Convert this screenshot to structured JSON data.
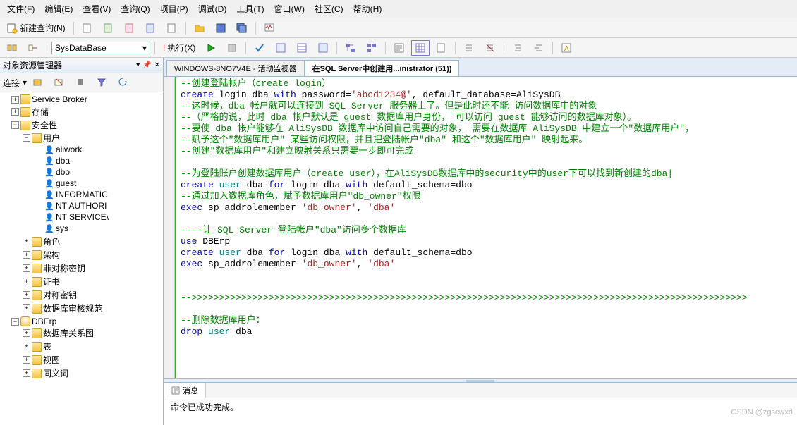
{
  "menu": {
    "file": "文件(F)",
    "edit": "编辑(E)",
    "view": "查看(V)",
    "query": "查询(Q)",
    "project": "项目(P)",
    "debug": "调试(D)",
    "tools": "工具(T)",
    "window": "窗口(W)",
    "community": "社区(C)",
    "help": "帮助(H)"
  },
  "toolbar1": {
    "newquery": "新建查询(N)"
  },
  "toolbar2": {
    "database": "SysDataBase",
    "execute": "执行(X)"
  },
  "left_panel": {
    "title": "对象资源管理器",
    "connect": "连接"
  },
  "tree": {
    "svc_broker": "Service Broker",
    "storage": "存储",
    "security": "安全性",
    "users": "用户",
    "u_aliwork": "aliwork",
    "u_dba": "dba",
    "u_dbo": "dbo",
    "u_guest": "guest",
    "u_info": "INFORMATIC",
    "u_nta": "NT AUTHORI",
    "u_nts": "NT SERVICE\\",
    "u_sys": "sys",
    "roles": "角色",
    "schemas": "架构",
    "asymkeys": "非对称密钥",
    "certs": "证书",
    "symkeys": "对称密钥",
    "audit": "数据库审核规范",
    "dberp": "DBErp",
    "diagrams": "数据库关系图",
    "tables": "表",
    "views": "视图",
    "synonyms": "同义词"
  },
  "tabs": {
    "t1": "WINDOWS-8NO7V4E - 活动监视器",
    "t2": "在SQL Server中创建用...inistrator (51))"
  },
  "code": [
    {
      "t": "--创建登陆帐户（create login）",
      "c": "green"
    },
    {
      "segments": [
        {
          "t": "create",
          "c": "blue"
        },
        {
          "t": " login dba ",
          "c": "black"
        },
        {
          "t": "with",
          "c": "blue"
        },
        {
          "t": " password",
          "c": "black"
        },
        {
          "t": "=",
          "c": "black"
        },
        {
          "t": "'abcd1234@'",
          "c": "red"
        },
        {
          "t": ", default_database",
          "c": "black"
        },
        {
          "t": "=",
          "c": "black"
        },
        {
          "t": "AliSysDB",
          "c": "black"
        }
      ]
    },
    {
      "t": "--这时候，dba 帐户就可以连接到 SQL Server 服务器上了。但是此时还不能 访问数据库中的对象",
      "c": "green"
    },
    {
      "t": "--（严格的说，此时 dba 帐户默认是 guest 数据库用户身份， 可以访问 guest 能够访问的数据库对象）。",
      "c": "green"
    },
    {
      "t": "--要使 dba 帐户能够在 AliSysDB 数据库中访问自己需要的对象， 需要在数据库 AliSysDB 中建立一个\"数据库用户\"，",
      "c": "green"
    },
    {
      "t": "--赋予这个\"数据库用户\" 某些访问权限，并且把登陆帐户\"dba\" 和这个\"数据库用户\" 映射起来。",
      "c": "green"
    },
    {
      "t": "--创建\"数据库用户\"和建立映射关系只需要一步即可完成",
      "c": "green"
    },
    {
      "t": "",
      "c": "black"
    },
    {
      "t": "--为登陆账户创建数据库用户（create user），在AliSysDB数据库中的security中的user下可以找到新创建的dba|",
      "c": "green"
    },
    {
      "segments": [
        {
          "t": "create",
          "c": "blue"
        },
        {
          "t": " ",
          "c": "black"
        },
        {
          "t": "user",
          "c": "teal"
        },
        {
          "t": " dba ",
          "c": "black"
        },
        {
          "t": "for",
          "c": "blue"
        },
        {
          "t": " login dba ",
          "c": "black"
        },
        {
          "t": "with",
          "c": "blue"
        },
        {
          "t": " default_schema",
          "c": "black"
        },
        {
          "t": "=",
          "c": "black"
        },
        {
          "t": "dbo",
          "c": "black"
        }
      ]
    },
    {
      "t": "--通过加入数据库角色，赋予数据库用户\"db_owner\"权限",
      "c": "green"
    },
    {
      "segments": [
        {
          "t": "exec",
          "c": "blue"
        },
        {
          "t": " sp_addrolemember ",
          "c": "black"
        },
        {
          "t": "'db_owner'",
          "c": "red"
        },
        {
          "t": ", ",
          "c": "black"
        },
        {
          "t": "'dba'",
          "c": "red"
        }
      ]
    },
    {
      "t": "",
      "c": "black"
    },
    {
      "t": "----让 SQL Server 登陆帐户\"dba\"访问多个数据库",
      "c": "green"
    },
    {
      "segments": [
        {
          "t": "use",
          "c": "blue"
        },
        {
          "t": " DBErp",
          "c": "black"
        }
      ]
    },
    {
      "segments": [
        {
          "t": "create",
          "c": "blue"
        },
        {
          "t": " ",
          "c": "black"
        },
        {
          "t": "user",
          "c": "teal"
        },
        {
          "t": " dba ",
          "c": "black"
        },
        {
          "t": "for",
          "c": "blue"
        },
        {
          "t": " login dba ",
          "c": "black"
        },
        {
          "t": "with",
          "c": "blue"
        },
        {
          "t": " default_schema",
          "c": "black"
        },
        {
          "t": "=",
          "c": "black"
        },
        {
          "t": "dbo",
          "c": "black"
        }
      ]
    },
    {
      "segments": [
        {
          "t": "exec",
          "c": "blue"
        },
        {
          "t": " sp_addrolemember ",
          "c": "black"
        },
        {
          "t": "'db_owner'",
          "c": "red"
        },
        {
          "t": ", ",
          "c": "black"
        },
        {
          "t": "'dba'",
          "c": "red"
        }
      ]
    },
    {
      "t": "",
      "c": "black"
    },
    {
      "t": "",
      "c": "black"
    },
    {
      "t": "-->>>>>>>>>>>>>>>>>>>>>>>>>>>>>>>>>>>>>>>>>>>>>>>>>>>>>>>>>>>>>>>>>>>>>>>>>>>>>>>>>>>>>>>>>>>>>>>>>>>>>",
      "c": "green"
    },
    {
      "t": "",
      "c": "black"
    },
    {
      "t": "--删除数据库用户：",
      "c": "green"
    },
    {
      "segments": [
        {
          "t": "drop",
          "c": "blue"
        },
        {
          "t": " ",
          "c": "black"
        },
        {
          "t": "user",
          "c": "teal"
        },
        {
          "t": " dba",
          "c": "black"
        }
      ]
    }
  ],
  "messages": {
    "tab": "消息",
    "text": "命令已成功完成。"
  },
  "watermark": "CSDN @zgscwxd"
}
